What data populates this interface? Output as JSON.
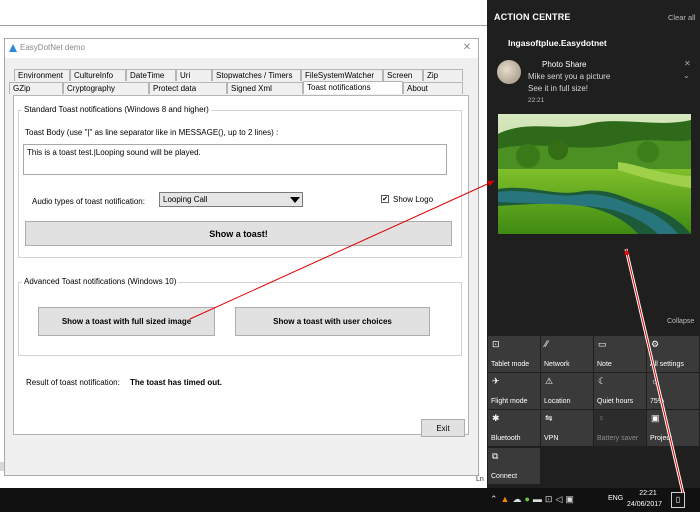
{
  "window": {
    "title": "EasyDotNet demo",
    "tabs_row1": [
      "Environment",
      "CultureInfo",
      "DateTime",
      "Uri",
      "Stopwatches / Timers",
      "FileSystemWatcher",
      "Screen",
      "Zip"
    ],
    "tabs_row2": [
      "GZip",
      "Cryptography",
      "Protect data",
      "Signed Xml",
      "Toast notifications",
      "About"
    ],
    "active_tab": "Toast notifications"
  },
  "standard": {
    "group_title": "Standard Toast notifications (Windows 8 and higher)",
    "body_label": "Toast Body (use \"|\" as line separator like in MESSAGE(), up to 2 lines) :",
    "body_value": "This is a toast test.|Looping sound will be played.",
    "audio_label": "Audio types of toast notification:",
    "audio_selected": "Looping Call",
    "show_logo_label": "Show Logo",
    "show_logo_checked": "✔",
    "show_toast_label": "Show a toast!"
  },
  "advanced": {
    "group_title": "Advanced Toast notifications (Windows 10)",
    "full_image_label": "Show a toast with full sized image",
    "user_choices_label": "Show a toast with user choices"
  },
  "result": {
    "label": "Result of toast notification:",
    "value": "The toast has timed out."
  },
  "exit_label": "Exit",
  "bg_fragment": "Ln",
  "action_centre": {
    "title": "ACTION CENTRE",
    "clear_all": "Clear all",
    "app_name": "Ingasoftplue.Easydotnet",
    "notification": {
      "title": "Photo Share",
      "line1": "Mike sent you a picture",
      "line2": "See it in full size!",
      "time": "22:21"
    },
    "collapse": "Collapse",
    "tiles": [
      {
        "label": "Tablet mode",
        "icon": "tablet-mode-icon",
        "glyph": "⊡"
      },
      {
        "label": "Network",
        "icon": "network-icon",
        "glyph": "⁄⁄"
      },
      {
        "label": "Note",
        "icon": "note-icon",
        "glyph": "▭"
      },
      {
        "label": "All settings",
        "icon": "gear-icon",
        "glyph": "⚙"
      },
      {
        "label": "Flight mode",
        "icon": "airplane-icon",
        "glyph": "✈"
      },
      {
        "label": "Location",
        "icon": "location-icon",
        "glyph": "⚠"
      },
      {
        "label": "Quiet hours",
        "icon": "moon-icon",
        "glyph": "☾"
      },
      {
        "label": "75%",
        "icon": "brightness-icon",
        "glyph": "☼"
      },
      {
        "label": "Bluetooth",
        "icon": "bluetooth-icon",
        "glyph": "✱"
      },
      {
        "label": "VPN",
        "icon": "vpn-icon",
        "glyph": "⇋"
      },
      {
        "label": "Battery saver",
        "icon": "battery-saver-icon",
        "glyph": "♀"
      },
      {
        "label": "Project",
        "icon": "project-icon",
        "glyph": "▣"
      },
      {
        "label": "Connect",
        "icon": "connect-icon",
        "glyph": "⧉"
      }
    ]
  },
  "taskbar": {
    "language": "ENG",
    "time": "22:21",
    "date": "24/06/2017"
  }
}
